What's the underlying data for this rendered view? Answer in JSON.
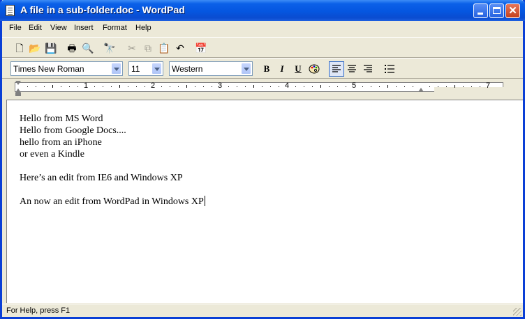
{
  "window": {
    "title": "A file in a sub-folder.doc - WordPad"
  },
  "menu": [
    "File",
    "Edit",
    "View",
    "Insert",
    "Format",
    "Help"
  ],
  "toolbar": {
    "buttons": [
      {
        "name": "new-document-icon",
        "glyph": "🗋"
      },
      {
        "name": "open-folder-icon",
        "glyph": "📂"
      },
      {
        "name": "save-icon",
        "glyph": "💾"
      },
      {
        "name": "print-icon",
        "glyph": "🖶"
      },
      {
        "name": "print-preview-icon",
        "glyph": "🔍"
      },
      {
        "name": "find-icon",
        "glyph": "🔭"
      },
      {
        "name": "cut-icon",
        "glyph": "✂"
      },
      {
        "name": "copy-icon",
        "glyph": "⧉"
      },
      {
        "name": "paste-icon",
        "glyph": "📋"
      },
      {
        "name": "undo-icon",
        "glyph": "↶"
      },
      {
        "name": "insert-datetime-icon",
        "glyph": "📅"
      }
    ]
  },
  "format_bar": {
    "font": "Times New Roman",
    "size": "11",
    "script": "Western",
    "bold": "B",
    "italic": "I",
    "underline": "U",
    "color_icon": "palette-icon",
    "align": {
      "left": "align-left-icon",
      "center": "align-center-icon",
      "right": "align-right-icon"
    },
    "bullets": "bullets-icon"
  },
  "ruler": {
    "numbers": [
      "1",
      "2",
      "3",
      "4",
      "5",
      "7"
    ]
  },
  "document": {
    "lines": [
      "Hello from MS Word",
      "Hello from Google Docs....",
      "hello from an iPhone",
      "or even a Kindle",
      "",
      "Here’s an edit from IE6 and Windows XP",
      "",
      "An now an edit from WordPad in Windows XP"
    ]
  },
  "status": {
    "text": "For Help, press F1"
  },
  "colors": {
    "titlebar": "#0556e0",
    "chrome": "#ece9d8",
    "close": "#c4401c"
  }
}
